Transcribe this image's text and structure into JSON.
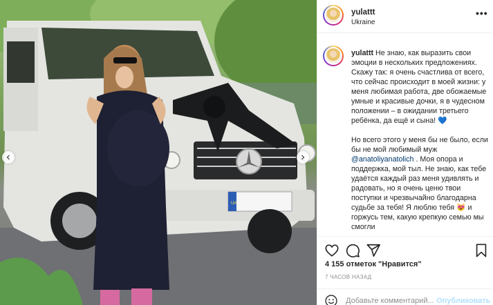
{
  "post": {
    "username": "yulattt",
    "location": "Ukraine",
    "more_glyph": "•••",
    "plate_text": "UA",
    "caption": {
      "username": "yulattt",
      "p1": "Не знаю, как выразить свои эмоции в нескольких предложениях. Скажу так: я очень счастлива от всего, что сейчас происходит в моей жизни: у меня любимая работа, две обожаемые умные и красивые дочки, я в чудесном положении – в ожидании третьего ребёнка, да ещё и сына!",
      "p1_emoji": "💙",
      "p2_start": "Но всего этого у меня бы не было, если бы не мой любимый муж",
      "mention": "@anatoliyanatolich",
      "p2_mid": ". Моя опора и поддержка, мой тыл. Не знаю, как тебе удаётся каждый раз меня удивлять и радовать, но я очень ценю твои поступки и чрезвычайно благодарна судьбе за тебя! Я люблю тебя",
      "p2_emoji": "😻",
      "p2_end": "и горжусь тем, какую крепкую семью мы смогли"
    },
    "likes": "4 155 отметок \"Нравится\"",
    "time": "7 ЧАСОВ НАЗАД",
    "comment": {
      "placeholder": "Добавьте комментарий...",
      "publish": "Опубликовать"
    }
  },
  "icons": {
    "like": "heart-outline-icon",
    "comment": "comment-bubble-icon",
    "share": "paper-plane-icon",
    "save": "bookmark-icon",
    "emoji": "smiley-icon",
    "prev": "chevron-left-icon",
    "next": "chevron-right-icon"
  },
  "colors": {
    "mention": "#00376b",
    "publish_disabled": "#b2dffc",
    "heart": "#3897f0",
    "meta_gray": "#8e8e8e"
  }
}
